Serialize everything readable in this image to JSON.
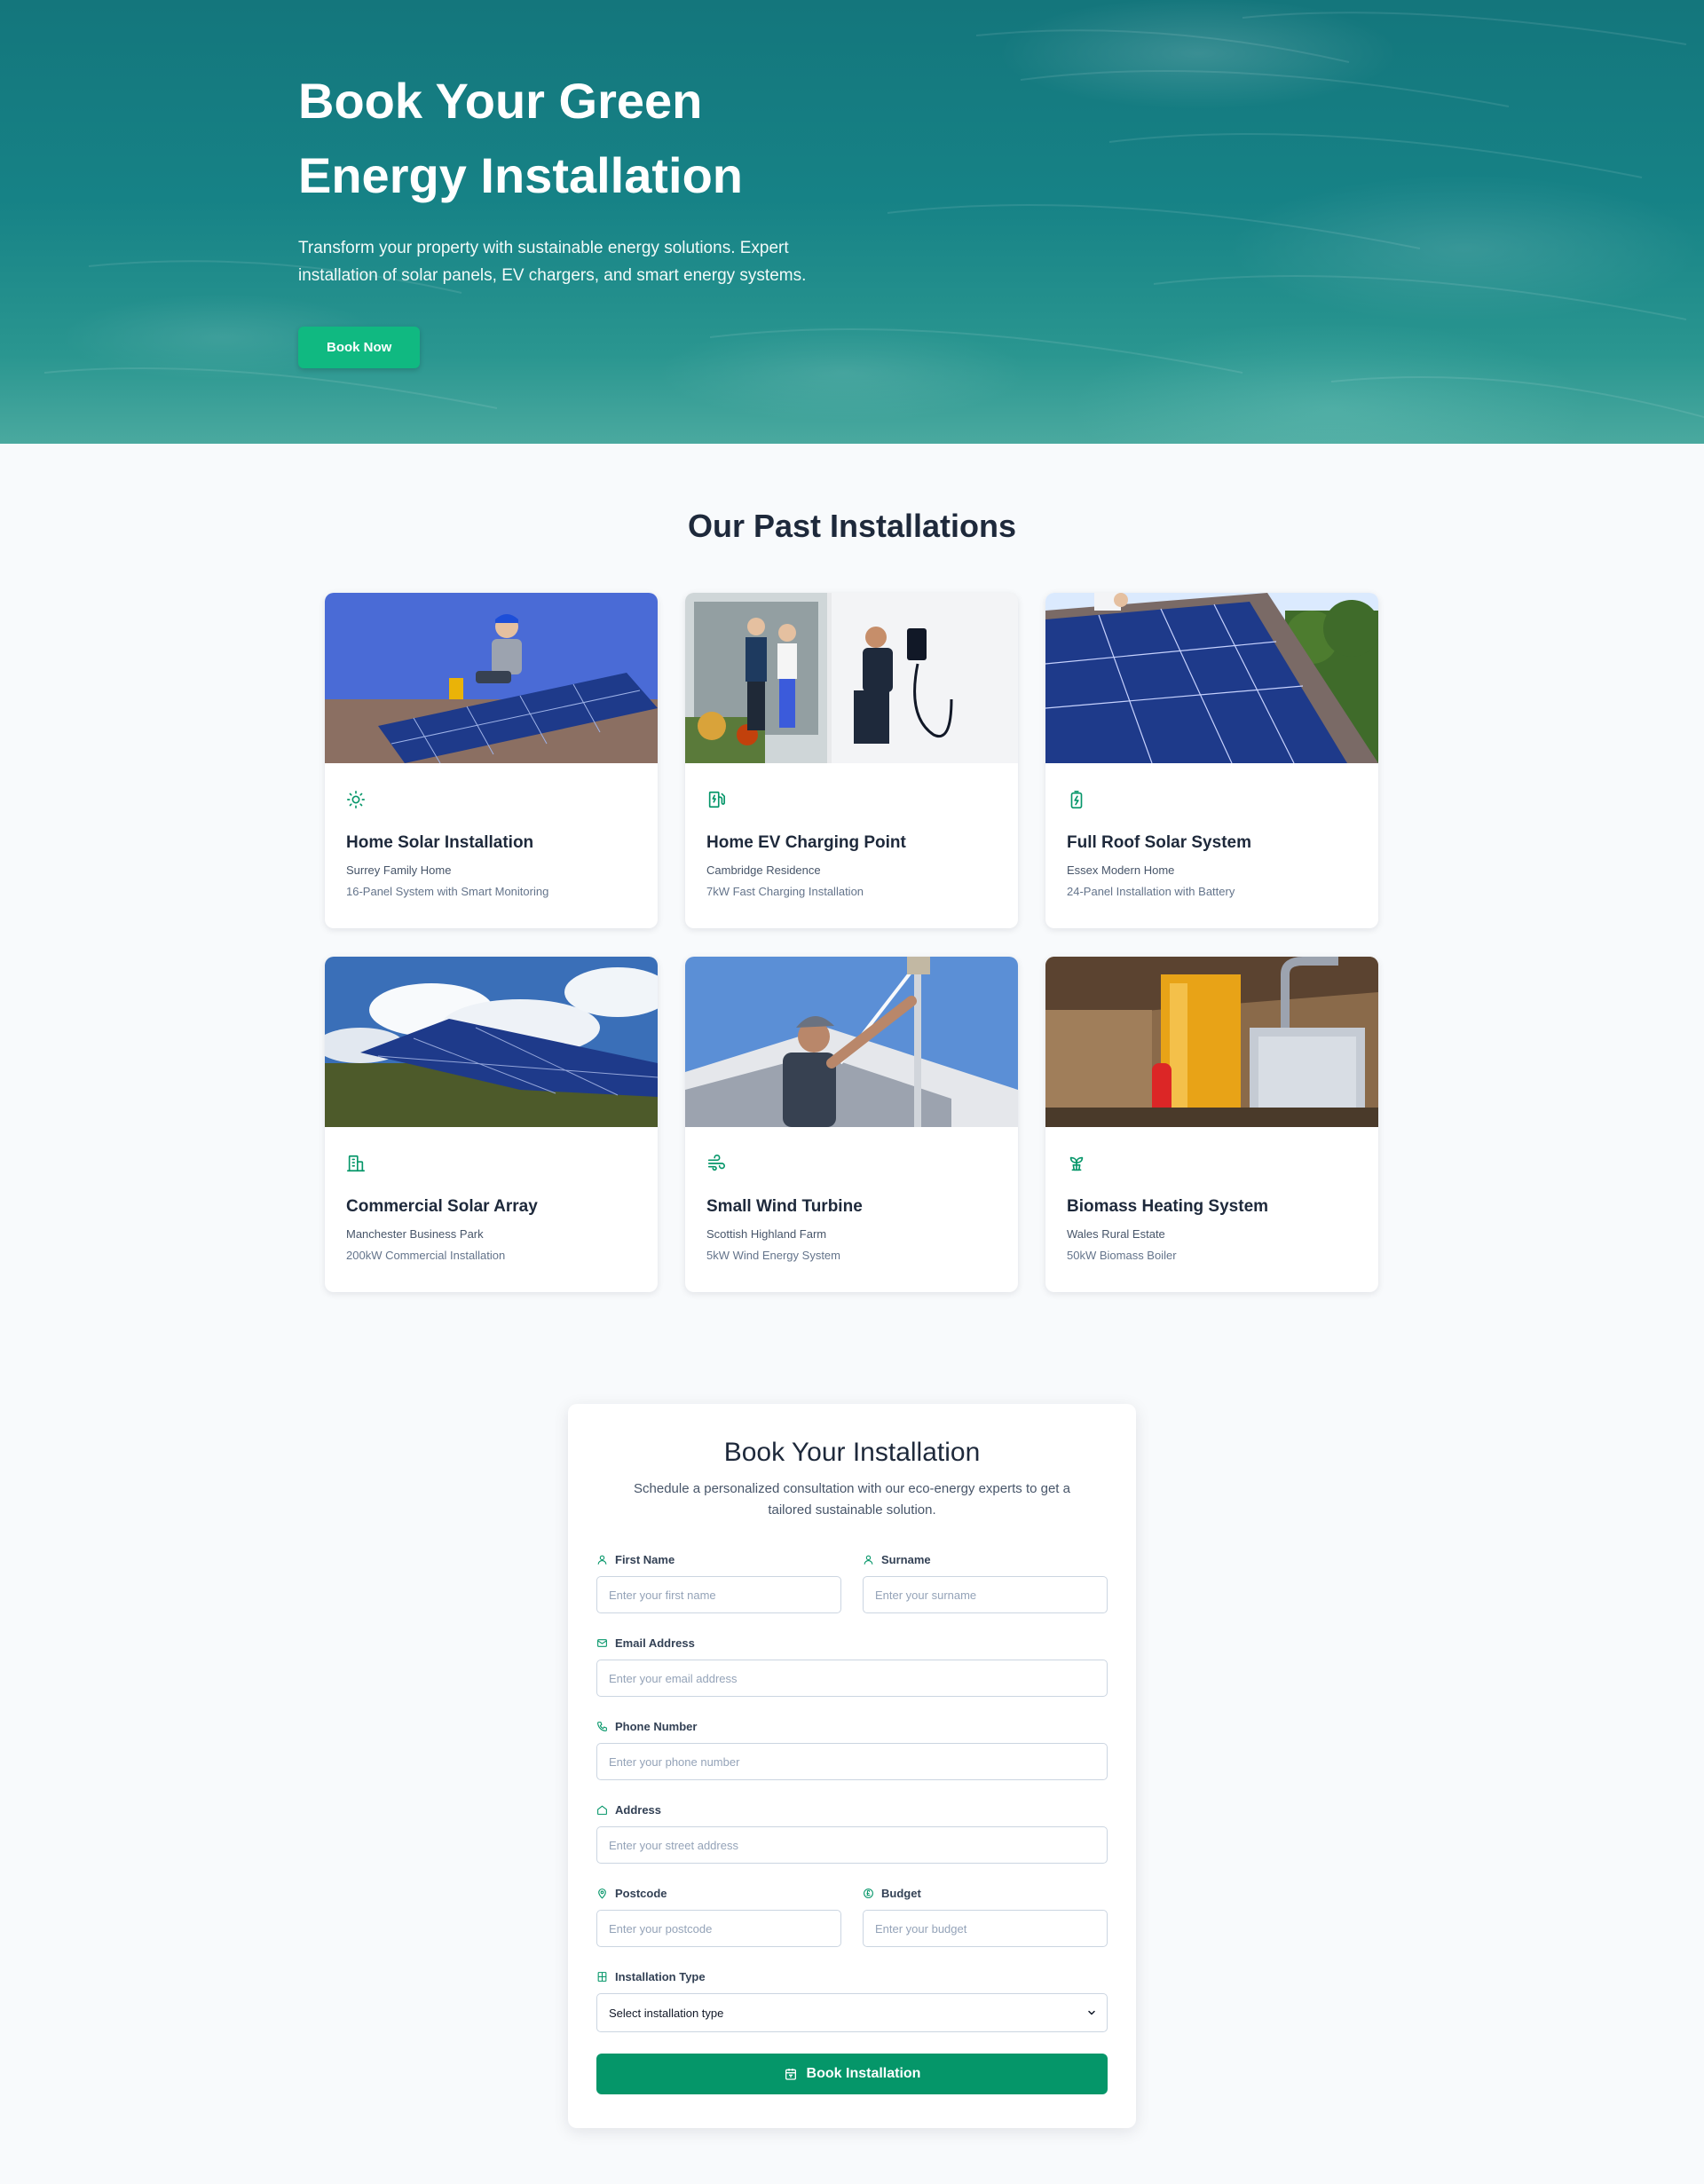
{
  "hero": {
    "title_line1": "Book Your Green",
    "title_line2": "Energy Installation",
    "subtitle": "Transform your property with sustainable energy solutions. Expert installation of solar panels, EV chargers, and smart energy systems.",
    "cta_label": "Book Now"
  },
  "installations": {
    "title": "Our Past Installations",
    "items": [
      {
        "icon": "sun-icon",
        "title": "Home Solar Installation",
        "location": "Surrey Family Home",
        "description": "16-Panel System with Smart Monitoring"
      },
      {
        "icon": "fuel-pump-icon",
        "title": "Home EV Charging Point",
        "location": "Cambridge Residence",
        "description": "7kW Fast Charging Installation"
      },
      {
        "icon": "battery-charging-icon",
        "title": "Full Roof Solar System",
        "location": "Essex Modern Home",
        "description": "24-Panel Installation with Battery"
      },
      {
        "icon": "building-icon",
        "title": "Commercial Solar Array",
        "location": "Manchester Business Park",
        "description": "200kW Commercial Installation"
      },
      {
        "icon": "wind-icon",
        "title": "Small Wind Turbine",
        "location": "Scottish Highland Farm",
        "description": "5kW Wind Energy System"
      },
      {
        "icon": "sprout-icon",
        "title": "Biomass Heating System",
        "location": "Wales Rural Estate",
        "description": "50kW Biomass Boiler"
      }
    ]
  },
  "form": {
    "title": "Book Your Installation",
    "subtitle": "Schedule a personalized consultation with our eco-energy experts to get a tailored sustainable solution.",
    "first_name": {
      "label": "First Name",
      "placeholder": "Enter your first name"
    },
    "surname": {
      "label": "Surname",
      "placeholder": "Enter your surname"
    },
    "email": {
      "label": "Email Address",
      "placeholder": "Enter your email address"
    },
    "phone": {
      "label": "Phone Number",
      "placeholder": "Enter your phone number"
    },
    "address": {
      "label": "Address",
      "placeholder": "Enter your street address"
    },
    "postcode": {
      "label": "Postcode",
      "placeholder": "Enter your postcode"
    },
    "budget": {
      "label": "Budget",
      "placeholder": "Enter your budget"
    },
    "installation_type": {
      "label": "Installation Type",
      "selected": "Select installation type"
    },
    "submit_label": "Book Installation"
  },
  "colors": {
    "accent": "#10b981",
    "accent_dark": "#059669",
    "hero_teal": "#168286"
  }
}
